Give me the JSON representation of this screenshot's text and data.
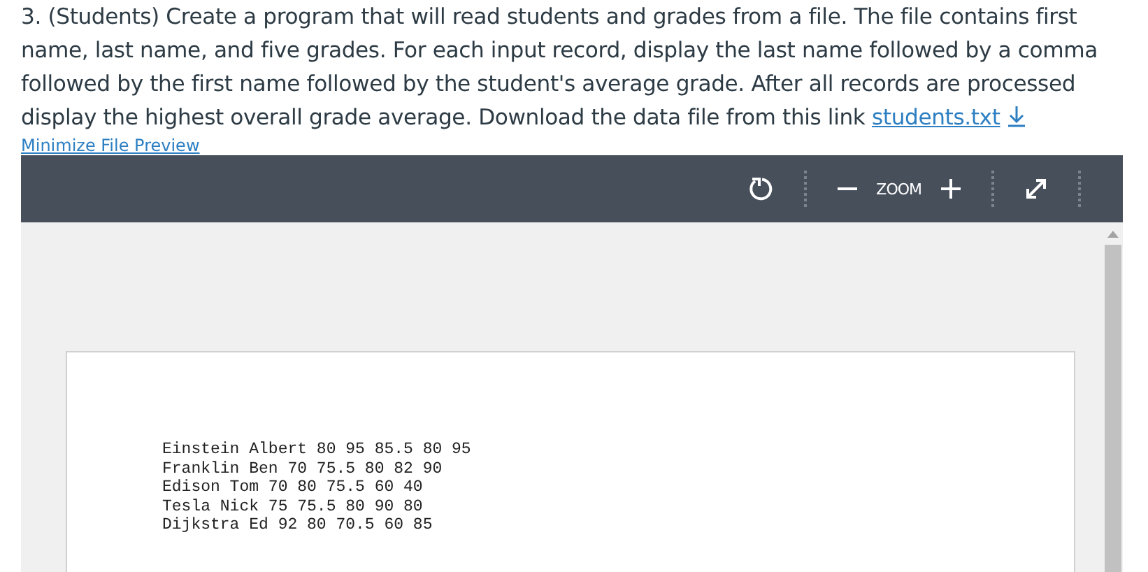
{
  "question": {
    "text": "3. (Students) Create a program that will read students and grades from a file. The file contains first name, last name, and five grades. For each input record, display the last name followed by a comma followed by the first name followed by the student's average grade. After all records are processed display the highest overall grade average. Download the data file from this link",
    "link": "students.txt"
  },
  "minimize_link": "Minimize File Preview",
  "toolbar": {
    "zoom_label": "ZOOM"
  },
  "document_lines": [
    "Einstein Albert 80 95 85.5 80 95",
    "Franklin Ben 70 75.5 80 82 90",
    "Edison Tom 70 80 75.5 60 40",
    "Tesla Nick 75 75.5 80 90 80",
    "Dijkstra Ed 92 80 70.5 60 85"
  ]
}
